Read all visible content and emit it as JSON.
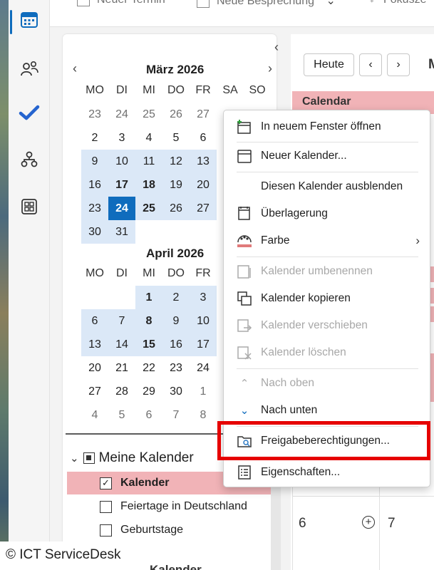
{
  "topbar": {
    "new_appointment": "Neuer Termin",
    "new_meeting": "Neue Besprechung",
    "focus": "Fokusze"
  },
  "rail": {
    "items": [
      "calendar-icon",
      "people-icon",
      "todo-check-icon",
      "org-chart-icon",
      "apps-grid-icon"
    ]
  },
  "nav": {
    "collapse_glyph": "‹",
    "march": {
      "title": "März 2026",
      "weekdays": [
        "MO",
        "DI",
        "MI",
        "DO",
        "FR",
        "SA",
        "SO"
      ],
      "rows": [
        [
          "23",
          "24",
          "25",
          "26",
          "27",
          "",
          ""
        ],
        [
          "2",
          "3",
          "4",
          "5",
          "6",
          "",
          ""
        ],
        [
          "9",
          "10",
          "11",
          "12",
          "13",
          "",
          ""
        ],
        [
          "16",
          "17",
          "18",
          "19",
          "20",
          "",
          ""
        ],
        [
          "23",
          "24",
          "25",
          "26",
          "27",
          "",
          ""
        ],
        [
          "30",
          "31",
          "",
          "",
          "",
          "",
          ""
        ]
      ]
    },
    "april": {
      "title": "April 2026",
      "weekdays": [
        "MO",
        "DI",
        "MI",
        "DO",
        "FR"
      ],
      "rows": [
        [
          "",
          "",
          "1",
          "2",
          "3"
        ],
        [
          "6",
          "7",
          "8",
          "9",
          "10"
        ],
        [
          "13",
          "14",
          "15",
          "16",
          "17"
        ],
        [
          "20",
          "21",
          "22",
          "23",
          "24"
        ],
        [
          "27",
          "28",
          "29",
          "30",
          "1"
        ],
        [
          "4",
          "5",
          "6",
          "7",
          "8"
        ]
      ]
    },
    "group_title": "Meine Kalender",
    "calendars": [
      {
        "label": "Kalender",
        "checked": true
      },
      {
        "label": "Feiertage in Deutschland",
        "checked": false
      },
      {
        "label": "Geburtstage",
        "checked": false
      }
    ],
    "next_group_partial": "Kalender"
  },
  "calendar_view": {
    "today_button": "Heute",
    "prev_glyph": "‹",
    "next_glyph": "›",
    "header_label": "Calendar",
    "date_6": "6",
    "date_7": "7"
  },
  "context_menu": {
    "items": [
      {
        "label": "In neuem Fenster öffnen",
        "icon": "new-window-icon",
        "enabled": true
      },
      {
        "label": "Neuer Kalender...",
        "icon": "new-calendar-icon",
        "enabled": true
      },
      {
        "label": "Diesen Kalender ausblenden",
        "icon": "",
        "enabled": true
      },
      {
        "label": "Überlagerung",
        "icon": "overlay-icon",
        "enabled": true
      },
      {
        "label": "Farbe",
        "icon": "color-palette-icon",
        "enabled": true,
        "submenu": true
      },
      {
        "label": "Kalender umbenennen",
        "icon": "rename-icon",
        "enabled": false
      },
      {
        "label": "Kalender kopieren",
        "icon": "copy-icon",
        "enabled": true
      },
      {
        "label": "Kalender verschieben",
        "icon": "move-icon",
        "enabled": false
      },
      {
        "label": "Kalender löschen",
        "icon": "delete-calendar-icon",
        "enabled": false
      },
      {
        "label": "Nach oben",
        "icon": "chevron-up-icon",
        "enabled": false
      },
      {
        "label": "Nach unten",
        "icon": "chevron-down-icon",
        "enabled": true
      },
      {
        "label": "Freigabeberechtigungen...",
        "icon": "sharing-permissions-icon",
        "enabled": true
      },
      {
        "label": "Eigenschaften...",
        "icon": "properties-icon",
        "enabled": true
      }
    ],
    "submenu_glyph": "›"
  },
  "colors": {
    "accent": "#0f6cbd",
    "selected_calendar": "#f1b3b7",
    "highlight_box": "#e60000",
    "week_highlight": "#dbe8f7"
  },
  "footer": {
    "copyright": "© ICT ServiceDesk"
  }
}
